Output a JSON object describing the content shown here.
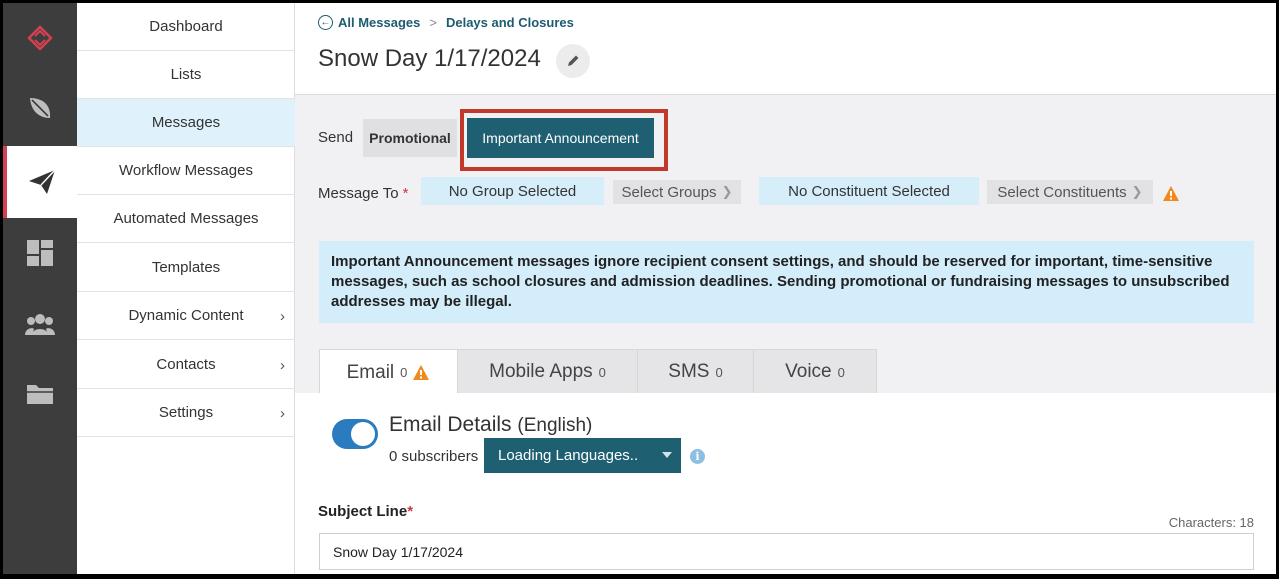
{
  "rail": {
    "items": [
      {
        "icon": "logo-icon"
      },
      {
        "icon": "feather-icon"
      },
      {
        "icon": "paper-plane-icon",
        "active": true
      },
      {
        "icon": "dashboard-grid-icon"
      },
      {
        "icon": "users-group-icon"
      },
      {
        "icon": "folder-icon"
      }
    ],
    "accent_color": "#d64050"
  },
  "sidebar": {
    "items": [
      {
        "label": "Dashboard"
      },
      {
        "label": "Lists"
      },
      {
        "label": "Messages",
        "active": true
      },
      {
        "label": "Workflow Messages"
      },
      {
        "label": "Automated Messages"
      },
      {
        "label": "Templates"
      },
      {
        "label": "Dynamic Content",
        "chevron": "›"
      },
      {
        "label": "Contacts",
        "chevron": "›"
      },
      {
        "label": "Settings",
        "chevron": "›"
      }
    ]
  },
  "breadcrumb": {
    "back_label": "All Messages",
    "separator": ">",
    "current": "Delays and Closures"
  },
  "page": {
    "title": "Snow Day 1/17/2024"
  },
  "send": {
    "label": "Send",
    "promotional_label": "Promotional",
    "important_label": "Important Announcement"
  },
  "message_to": {
    "label": "Message To",
    "required_marker": "*",
    "group_value": "No Group Selected",
    "select_groups_label": "Select Groups",
    "constituent_value": "No Constituent Selected",
    "select_constituents_label": "Select Constituents",
    "arrow": "❯"
  },
  "notice": {
    "text": "Important Announcement messages ignore recipient consent settings, and should be reserved for important, time-sensitive messages, such as school closures and admission deadlines. Sending promotional or fundraising messages to unsubscribed addresses may be illegal."
  },
  "tabs": [
    {
      "label": "Email",
      "count": "0",
      "warning": true,
      "active": true
    },
    {
      "label": "Mobile Apps",
      "count": "0"
    },
    {
      "label": "SMS",
      "count": "0"
    },
    {
      "label": "Voice",
      "count": "0"
    }
  ],
  "email_details": {
    "title": "Email Details",
    "language": "(English)",
    "subscribers": "0 subscribers",
    "language_button": "Loading Languages..",
    "info_glyph": "i",
    "toggle_on": true
  },
  "subject": {
    "label": "Subject Line",
    "required_marker": "*",
    "characters": "Characters: 18",
    "value": "Snow Day 1/17/2024"
  },
  "colors": {
    "primary": "#1f5f72",
    "highlight_border": "#c0392b",
    "notice_bg": "#d3edfa",
    "warning": "#f08a1c"
  }
}
